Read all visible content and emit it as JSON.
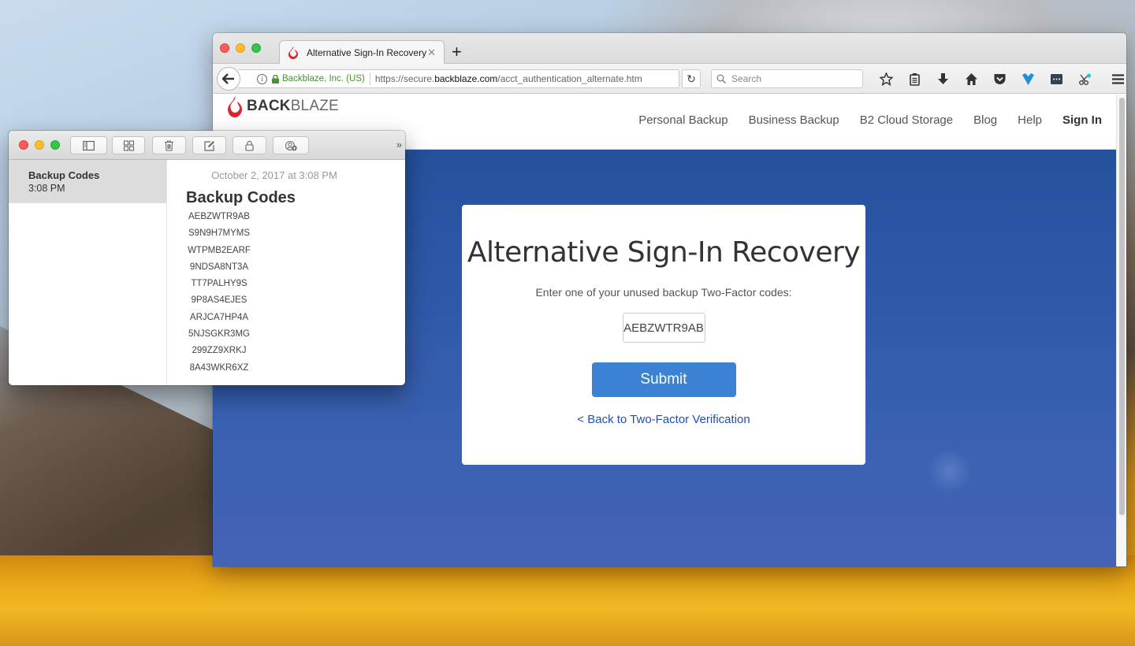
{
  "browser": {
    "tab": {
      "title": "Alternative Sign-In Recovery",
      "close_glyph": "✕"
    },
    "new_tab_glyph": "+",
    "url": {
      "identity": "Backblaze, Inc. (US)",
      "scheme": "https://secure.",
      "host": "backblaze.com",
      "path": "/acct_authentication_alternate.htm"
    },
    "search_placeholder": "Search",
    "reload_glyph": "↻",
    "toolbar_icons": [
      "star-icon",
      "reading-list-icon",
      "download-icon",
      "home-icon",
      "pocket-icon",
      "extension-heart-icon",
      "extension-password-icon",
      "extension-scissors-icon",
      "menu-icon"
    ]
  },
  "site": {
    "logo": {
      "part1": "BACK",
      "part2": "BLAZE"
    },
    "nav": [
      {
        "label": "Personal Backup"
      },
      {
        "label": "Business Backup"
      },
      {
        "label": "B2 Cloud Storage"
      },
      {
        "label": "Blog"
      },
      {
        "label": "Help"
      },
      {
        "label": "Sign In"
      }
    ],
    "card": {
      "title": "Alternative Sign-In Recovery",
      "subtitle": "Enter one of your unused backup Two-Factor codes:",
      "code_value": "AEBZWTR9AB",
      "submit_label": "Submit",
      "back_link": "< Back to Two-Factor Verification"
    },
    "colors": {
      "accent": "#3b82d4",
      "link": "#1f4fb3",
      "hero": "#2f5aaa"
    }
  },
  "notes": {
    "more_glyph": "»",
    "list": [
      {
        "title": "Backup Codes",
        "time": "3:08 PM"
      }
    ],
    "note": {
      "date": "October 2, 2017 at 3:08 PM",
      "heading": "Backup Codes",
      "codes": [
        "AEBZWTR9AB",
        "S9N9H7MYMS",
        "WTPMB2EARF",
        "9NDSA8NT3A",
        "TT7PALHY9S",
        "9P8AS4EJES",
        "ARJCA7HP4A",
        "5NJSGKR3MG",
        "299ZZ9XRKJ",
        "8A43WKR6XZ"
      ]
    }
  }
}
